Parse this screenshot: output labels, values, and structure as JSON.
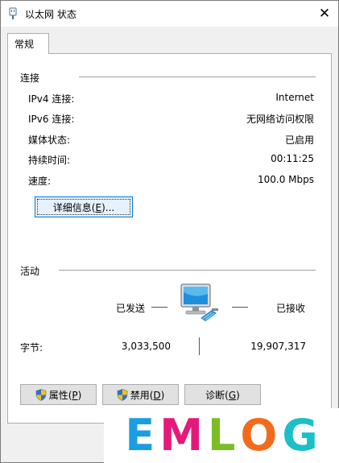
{
  "window": {
    "title": "以太网 状态",
    "close_glyph": "✕"
  },
  "tabs": [
    {
      "label": "常规"
    }
  ],
  "connection": {
    "heading": "连接",
    "rows": [
      {
        "label": "IPv4 连接:",
        "value": "Internet"
      },
      {
        "label": "IPv6 连接:",
        "value": "无网络访问权限"
      },
      {
        "label": "媒体状态:",
        "value": "已启用"
      },
      {
        "label": "持续时间:",
        "value": "00:11:25"
      },
      {
        "label": "速度:",
        "value": "100.0 Mbps"
      }
    ],
    "details_button": {
      "text": "详细信息(",
      "key": "E",
      "suffix": ")..."
    }
  },
  "activity": {
    "heading": "活动",
    "sent_label": "已发送",
    "received_label": "已接收",
    "bytes_label": "字节:",
    "bytes_sent": "3,033,500",
    "bytes_received": "19,907,317"
  },
  "buttons": {
    "properties": {
      "text": "属性(",
      "key": "P",
      "suffix": ")"
    },
    "disable": {
      "text": "禁用(",
      "key": "D",
      "suffix": ")"
    },
    "diagnose": {
      "text": "诊断(",
      "key": "G",
      "suffix": ")"
    }
  },
  "watermark": {
    "letters": [
      "E",
      "M",
      "L",
      "O",
      "G"
    ],
    "colors": [
      "#1b9de2",
      "#e6197b",
      "#7cbd26",
      "#f26b1d",
      "#1bbfc6"
    ]
  },
  "icons": {
    "title": "network-adapter-icon",
    "activity": "network-computer-icon",
    "shield": "uac-shield-icon"
  }
}
